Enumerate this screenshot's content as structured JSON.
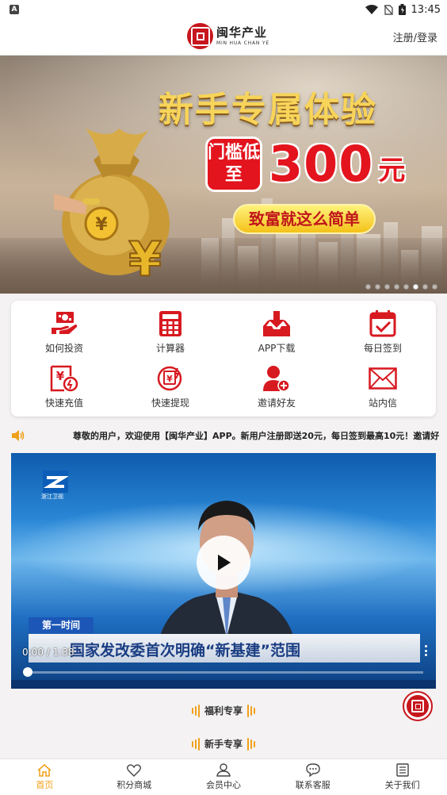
{
  "status_bar": {
    "time": "13:45",
    "notif_badge": "A"
  },
  "header": {
    "brand_cn": "闽华产业",
    "brand_en": "MIN HUA CHAN YE",
    "login_link": "注册/登录"
  },
  "banner": {
    "headline": "新手专属体验",
    "threshold_label": "门槛低至",
    "threshold_amount": "300",
    "threshold_unit": "元",
    "slogan": "致富就这么简单",
    "page_dots": 8,
    "active_dot": 6
  },
  "quick_menu": [
    {
      "label": "如何投资",
      "icon": "money-hand-icon"
    },
    {
      "label": "计算器",
      "icon": "calculator-icon"
    },
    {
      "label": "APP下载",
      "icon": "download-tray-icon"
    },
    {
      "label": "每日签到",
      "icon": "calendar-check-icon"
    },
    {
      "label": "快速充值",
      "icon": "recharge-icon"
    },
    {
      "label": "快速提现",
      "icon": "withdraw-icon"
    },
    {
      "label": "邀请好友",
      "icon": "invite-user-icon"
    },
    {
      "label": "站内信",
      "icon": "envelope-icon"
    }
  ],
  "notice": {
    "text": "尊敬的用户，欢迎使用【闽华产业】APP。新用户注册即送20元，每日签到最高10元！邀请好"
  },
  "video": {
    "channel": "浙江卫视",
    "tag": "第一时间",
    "headline": "国家发改委首次明确“新基建”范围",
    "time_current": "0:00",
    "time_total": "1:38",
    "time_display": "0:00 / 1:38",
    "progress": 0
  },
  "sections": {
    "welfare": "福利专享",
    "newbie": "新手专享"
  },
  "tabbar": [
    {
      "label": "首页",
      "active": true
    },
    {
      "label": "积分商城",
      "active": false
    },
    {
      "label": "会员中心",
      "active": false
    },
    {
      "label": "联系客服",
      "active": false
    },
    {
      "label": "关于我们",
      "active": false
    }
  ],
  "colors": {
    "brand_red": "#c7161d",
    "accent_orange": "#f0a019",
    "gold": "#f7d45a"
  }
}
